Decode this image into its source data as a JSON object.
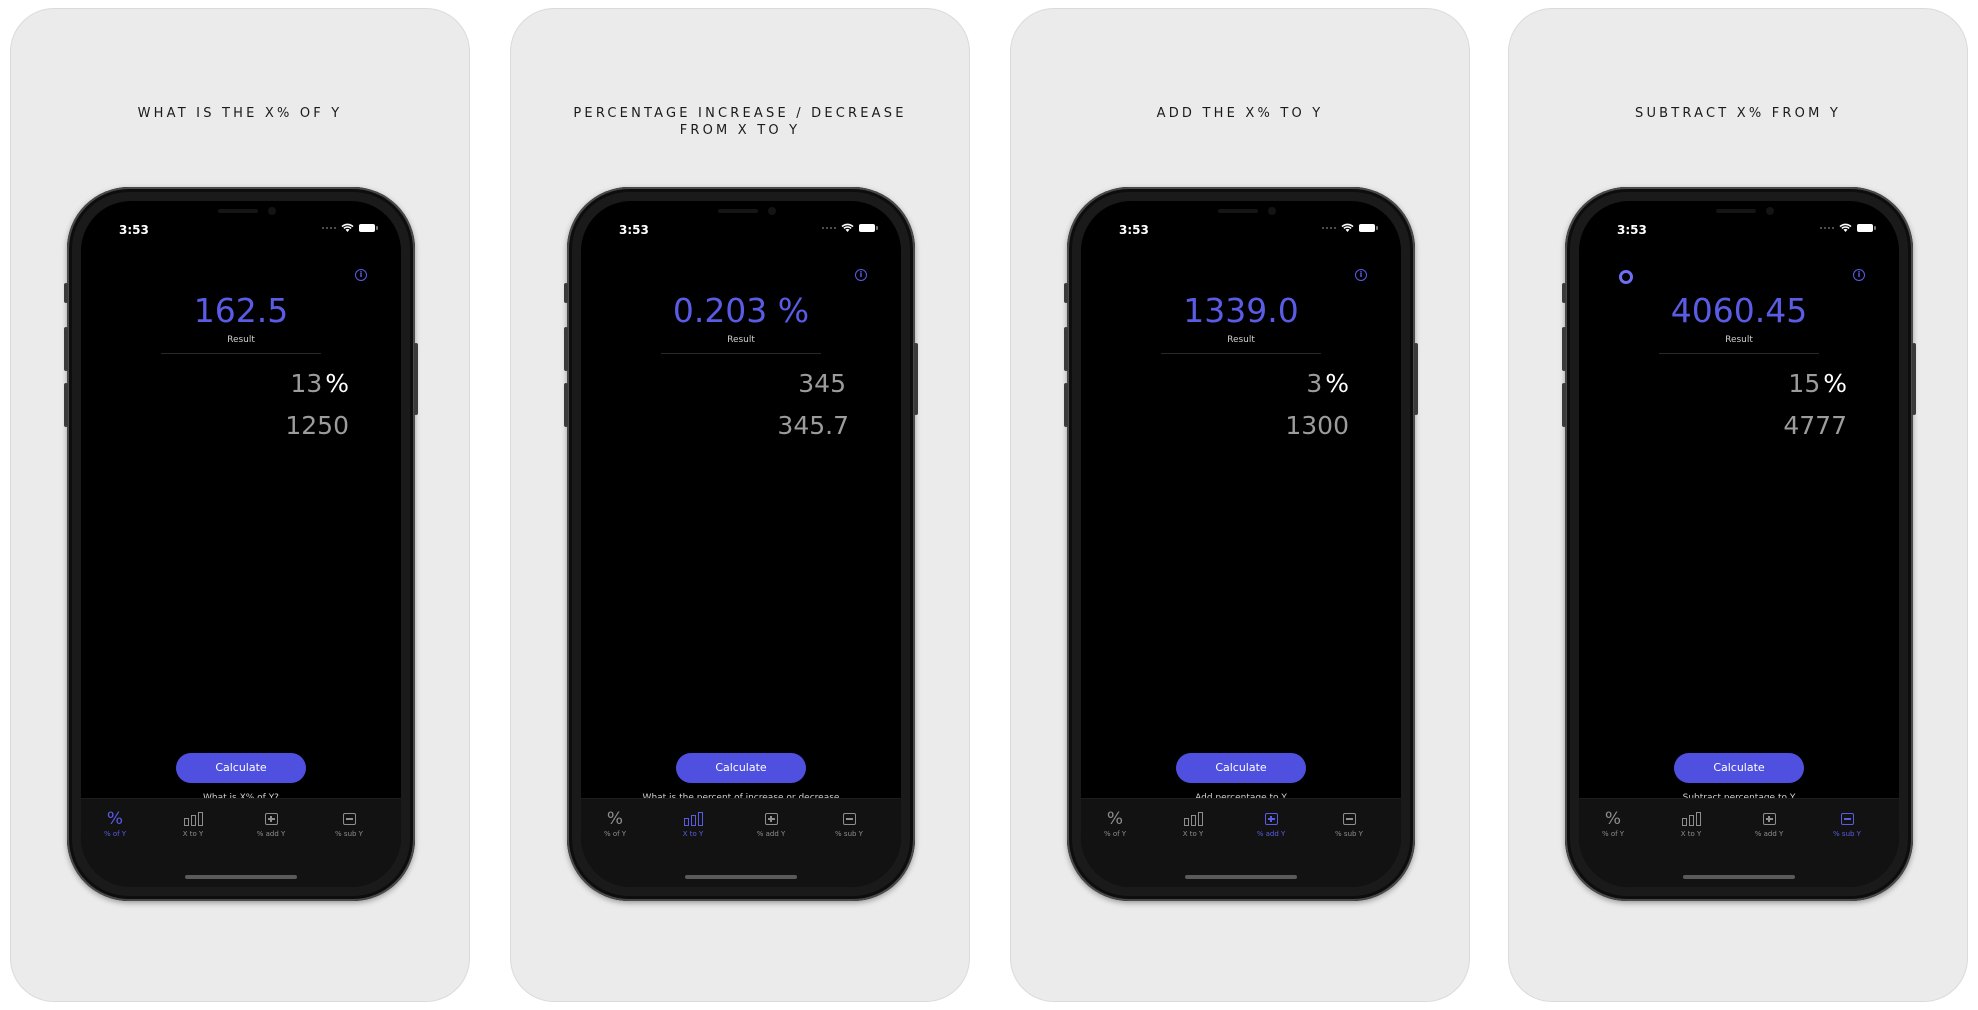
{
  "accent_color": "#5b5ce6",
  "status_time": "3:53",
  "result_label": "Result",
  "calculate_label": "Calculate",
  "tabs": [
    {
      "icon": "percent-icon",
      "label": "% of Y"
    },
    {
      "icon": "bar-chart-icon",
      "label": "X to Y"
    },
    {
      "icon": "plus-square-icon",
      "label": "% add Y"
    },
    {
      "icon": "minus-square-icon",
      "label": "% sub Y"
    }
  ],
  "panels": [
    {
      "caption": "WHAT IS THE X% OF Y",
      "result": "162.5",
      "input1": "13",
      "input1_suffix": "%",
      "input2": "1250",
      "description": "What is X% of Y?",
      "active_tab": 0
    },
    {
      "caption": "PERCENTAGE INCREASE / DECREASE\nFROM X TO Y",
      "result": "0.203 %",
      "input1": "345",
      "input1_suffix": "",
      "input2": "345.7",
      "description": "What is the percent of increase or decrease",
      "active_tab": 1
    },
    {
      "caption": "ADD THE X% TO Y",
      "result": "1339.0",
      "input1": "3",
      "input1_suffix": "%",
      "input2": "1300",
      "description": "Add percentage to Y",
      "active_tab": 2
    },
    {
      "caption": "SUBTRACT X% FROM Y",
      "result": "4060.45",
      "input1": "15",
      "input1_suffix": "%",
      "input2": "4777",
      "description": "Subtract percentage to Y",
      "active_tab": 3
    }
  ]
}
